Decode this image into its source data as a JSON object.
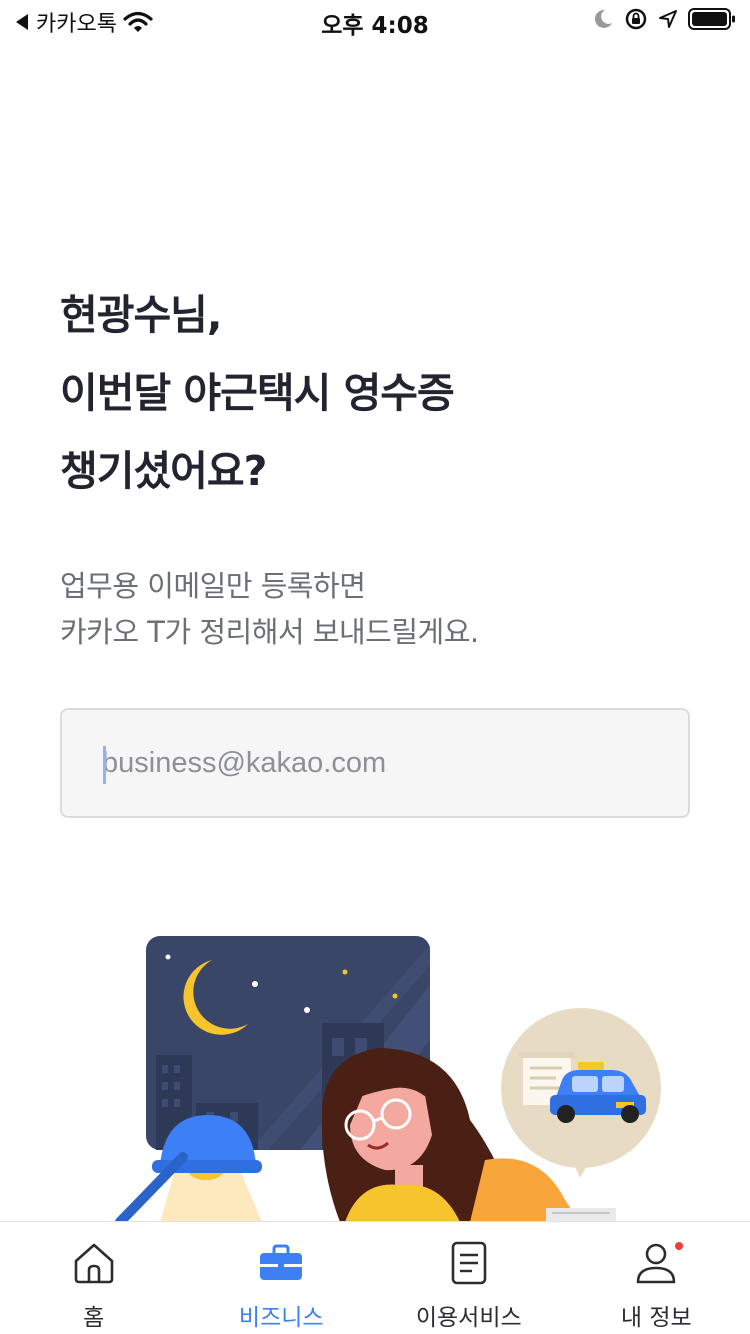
{
  "status_bar": {
    "back_label": "카카오톡",
    "time": "오후 4:08"
  },
  "headline": {
    "line1": "현광수님,",
    "line2": "이번달 야근택시 영수증",
    "line3": "챙기셨어요?"
  },
  "subtext": {
    "line1": "업무용 이메일만 등록하면",
    "line2": "카카오 T가 정리해서 보내드릴게요."
  },
  "email_input": {
    "value": "",
    "placeholder": "business@kakao.com"
  },
  "bottom_nav": {
    "items": [
      {
        "label": "홈",
        "icon": "home-icon",
        "active": false
      },
      {
        "label": "비즈니스",
        "icon": "briefcase-icon",
        "active": true
      },
      {
        "label": "이용서비스",
        "icon": "document-icon",
        "active": false
      },
      {
        "label": "내 정보",
        "icon": "person-icon",
        "active": false,
        "badge": true
      }
    ]
  },
  "colors": {
    "accent": "#3d7ff5",
    "headline": "#222530",
    "subtext": "#6b6f78",
    "badge": "#f23b3b",
    "night_sky": "#3a4668"
  }
}
